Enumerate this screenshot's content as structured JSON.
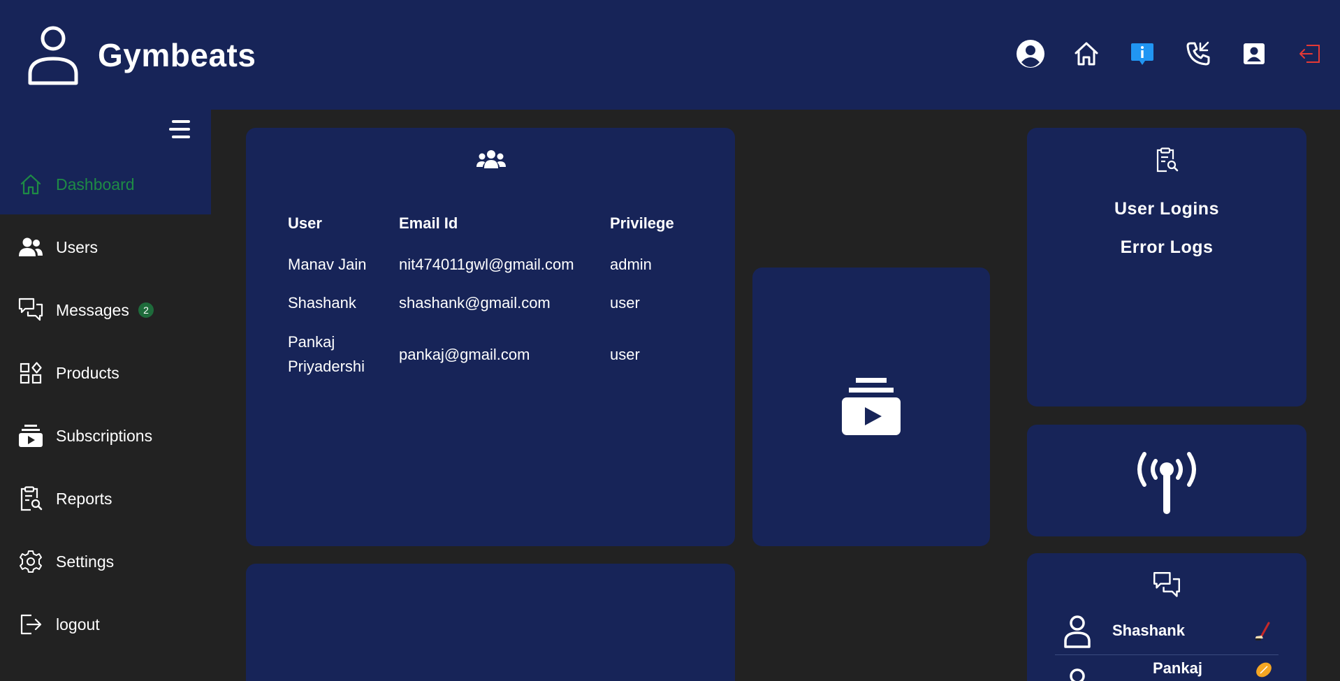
{
  "app": {
    "title": "Gymbeats"
  },
  "header": {
    "icons": [
      "account-circle-icon",
      "home-icon",
      "info-icon",
      "phone-icon",
      "contact-card-icon",
      "logout-icon"
    ]
  },
  "sidebar": {
    "items": [
      {
        "label": "Dashboard",
        "icon": "home-icon",
        "active": true
      },
      {
        "label": "Users",
        "icon": "users-icon"
      },
      {
        "label": "Messages",
        "icon": "messages-icon",
        "badge": "2"
      },
      {
        "label": "Products",
        "icon": "products-icon"
      },
      {
        "label": "Subscriptions",
        "icon": "subscriptions-icon"
      },
      {
        "label": "Reports",
        "icon": "reports-icon"
      },
      {
        "label": "Settings",
        "icon": "settings-icon"
      },
      {
        "label": "logout",
        "icon": "logout-icon"
      }
    ]
  },
  "users_table": {
    "headers": [
      "User",
      "Email Id",
      "Privilege"
    ],
    "rows": [
      {
        "user": "Manav Jain",
        "email": "nit474011gwl@gmail.com",
        "privilege": "admin"
      },
      {
        "user": "Shashank",
        "email": "shashank@gmail.com",
        "privilege": "user"
      },
      {
        "user_line1": "Pankaj",
        "user_line2": "Priyadershi",
        "email": "pankaj@gmail.com",
        "privilege": "user"
      }
    ]
  },
  "logs": {
    "user_logins": "User Logins",
    "error_logs": "Error Logs"
  },
  "chats": [
    {
      "name": "Shashank"
    },
    {
      "name": "Pankaj"
    }
  ],
  "colors": {
    "header_bg": "#172458",
    "page_bg": "#222222",
    "active": "#1e8b45",
    "info": "#2196f3",
    "logout": "#e53935"
  }
}
